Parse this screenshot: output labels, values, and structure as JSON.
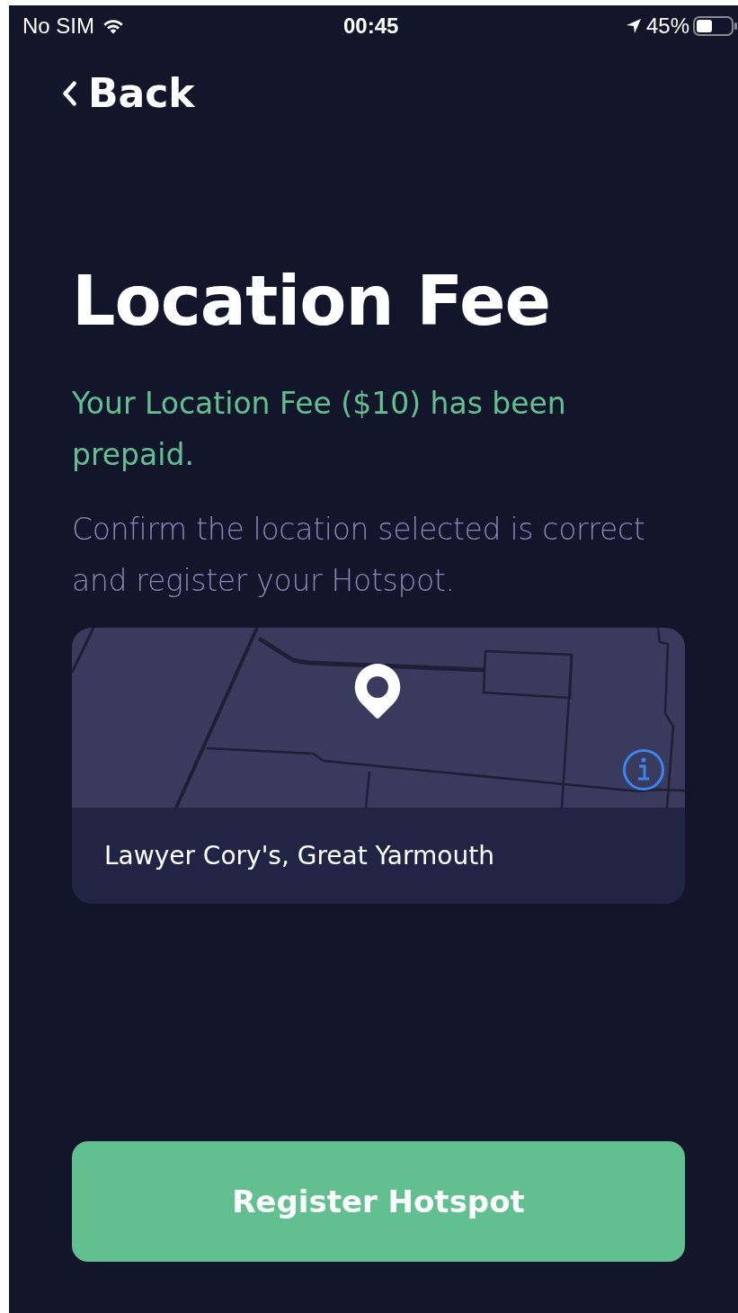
{
  "status_bar": {
    "carrier": "No SIM",
    "time": "00:45",
    "battery": "45%"
  },
  "back": {
    "label": "Back"
  },
  "title": "Location Fee",
  "prepaid_message": "Your Location Fee ($10) has been prepaid.",
  "instructions": "Confirm the location selected is correct and register your Hotspot.",
  "location_card": {
    "kind": "picture",
    "address": "Lawyer Cory's, Great Yarmouth"
  },
  "primary_button": {
    "label": "Register Hotspot"
  }
}
